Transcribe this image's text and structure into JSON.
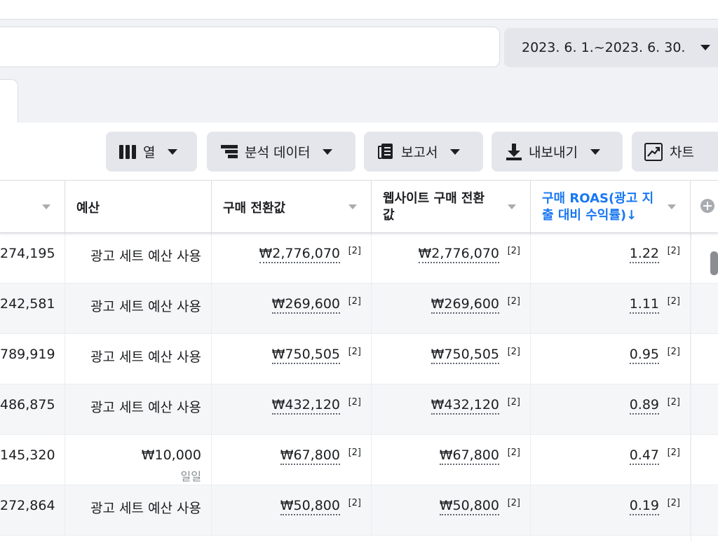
{
  "date_range": "2023. 6. 1.~2023. 6. 30.",
  "toolbar": {
    "columns_label": "열",
    "breakdown_label": "분석 데이터",
    "reports_label": "보고서",
    "export_label": "내보내기",
    "chart_label": "차트"
  },
  "table": {
    "headers": {
      "budget": "예산",
      "purchase_value": "구매 전환값",
      "website_purchase_value": "웹사이트 구매 전환 값",
      "purchase_roas": "구매 ROAS(광고 지출 대비 수익률)↓"
    },
    "footnote": "[2]",
    "rows": [
      {
        "spent": "274,195",
        "budget": "광고 세트 예산 사용",
        "budget_sub": "",
        "purchase_value": "₩2,776,070",
        "website_purchase_value": "₩2,776,070",
        "roas": "1.22"
      },
      {
        "spent": "242,581",
        "budget": "광고 세트 예산 사용",
        "budget_sub": "",
        "purchase_value": "₩269,600",
        "website_purchase_value": "₩269,600",
        "roas": "1.11"
      },
      {
        "spent": "789,919",
        "budget": "광고 세트 예산 사용",
        "budget_sub": "",
        "purchase_value": "₩750,505",
        "website_purchase_value": "₩750,505",
        "roas": "0.95"
      },
      {
        "spent": "486,875",
        "budget": "광고 세트 예산 사용",
        "budget_sub": "",
        "purchase_value": "₩432,120",
        "website_purchase_value": "₩432,120",
        "roas": "0.89"
      },
      {
        "spent": "145,320",
        "budget": "₩10,000",
        "budget_sub": "일일",
        "purchase_value": "₩67,800",
        "website_purchase_value": "₩67,800",
        "roas": "0.47"
      },
      {
        "spent": "272,864",
        "budget": "광고 세트 예산 사용",
        "budget_sub": "",
        "purchase_value": "₩50,800",
        "website_purchase_value": "₩50,800",
        "roas": "0.19"
      }
    ]
  },
  "colors": {
    "accent": "#1877f2",
    "button_bg": "#e4e6eb",
    "page_bg": "#f0f2f5"
  }
}
